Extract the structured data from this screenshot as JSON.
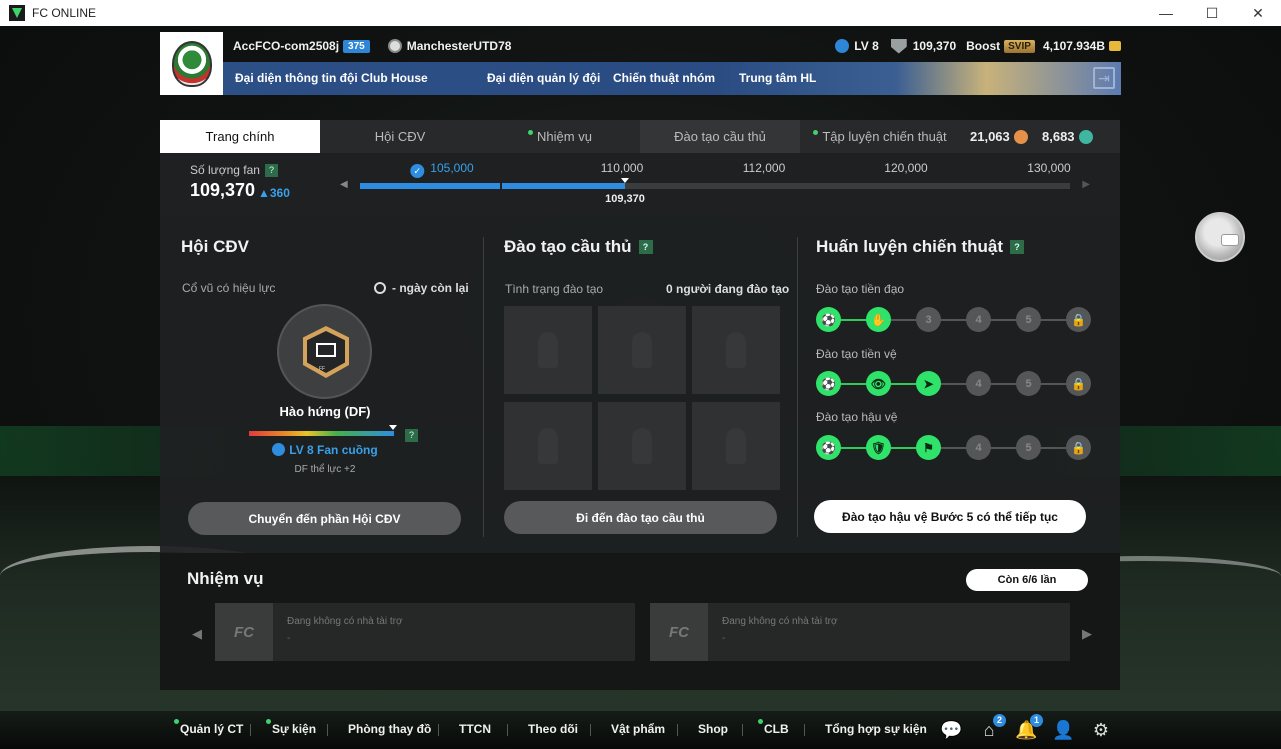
{
  "window": {
    "title": "FC ONLINE",
    "minimize": "—",
    "maximize": "☐",
    "close": "✕"
  },
  "header": {
    "account": "AccFCO-com2508j",
    "account_level": "375",
    "manager": "ManchesterUTD78",
    "level": "LV 8",
    "fans": "109,370",
    "boost_label": "Boost",
    "svip": "SVIP",
    "bp": "4,107.934B",
    "nav": [
      "Đại diện thông tin đội",
      "Club House",
      "Đại diện quản lý đội",
      "Chiến thuật nhóm",
      "Trung tâm HL"
    ],
    "exit_icon": "exit-icon"
  },
  "tabs": [
    {
      "label": "Trang chính",
      "active": true,
      "dot": false
    },
    {
      "label": "Hội CĐV",
      "active": false,
      "dot": false
    },
    {
      "label": "Nhiệm vụ",
      "active": false,
      "dot": true
    },
    {
      "label": "Đào tạo cầu thủ",
      "active": false,
      "dot": false
    },
    {
      "label": "Tập luyện chiến thuật",
      "active": false,
      "dot": true
    }
  ],
  "currency": {
    "orange": "21,063",
    "green": "8,683"
  },
  "fan_progress": {
    "label": "Số lượng fan",
    "help": "?",
    "value": "109,370",
    "delta": "▲360",
    "ticks": [
      "105,000",
      "110,000",
      "112,000",
      "120,000",
      "130,000"
    ],
    "current_label": "109,370",
    "reached_fraction": 0.373
  },
  "fan_club": {
    "title": "Hội CĐV",
    "effect_label": "Cổ vũ có hiệu lực",
    "days_left": "- ngày còn lại",
    "cheer_name": "Hào hứng (DF)",
    "fan_level": "LV 8 Fan cuồng",
    "bonus": "DF thể lực +2",
    "button": "Chuyển đến phần Hội CĐV",
    "badge_text": "FF"
  },
  "player_training": {
    "title": "Đào tạo cầu thủ",
    "status_label": "Tình trạng đào tạo",
    "status_value": "0 người đang đào tạo",
    "button": "Đi đến đào tạo cầu thủ"
  },
  "tactic_training": {
    "title": "Huấn luyện chiến thuật",
    "rows": [
      {
        "label": "Đào tạo tiền đạo",
        "steps": [
          "⚽",
          "✋",
          "3",
          "4",
          "5",
          "🔒"
        ],
        "done": 2
      },
      {
        "label": "Đào tạo tiền vệ",
        "steps": [
          "⚽",
          "👁",
          "➤",
          "4",
          "5",
          "🔒"
        ],
        "done": 3
      },
      {
        "label": "Đào tạo hậu vệ",
        "steps": [
          "⚽",
          "🛡",
          "⚑",
          "4",
          "5",
          "🔒"
        ],
        "done": 3
      }
    ],
    "button": "Đào tạo hậu vệ Bước 5 có thể tiếp tục"
  },
  "missions": {
    "title": "Nhiệm vụ",
    "count": "Còn 6/6 lần",
    "cards": [
      {
        "logo": "FC",
        "text": "Đang không có nhà tài trợ",
        "sub": "-"
      },
      {
        "logo": "FC",
        "text": "Đang không có nhà tài trợ",
        "sub": "-"
      }
    ],
    "prev": "◀",
    "next": "▶"
  },
  "bottom_nav": [
    {
      "label": "Quản lý CT",
      "dot": true
    },
    {
      "label": "Sự kiện",
      "dot": true
    },
    {
      "label": "Phòng thay đồ",
      "dot": false
    },
    {
      "label": "TTCN",
      "dot": false
    },
    {
      "label": "Theo dõi",
      "dot": false
    },
    {
      "label": "Vật phẩm",
      "dot": false
    },
    {
      "label": "Shop",
      "dot": false
    },
    {
      "label": "CLB",
      "dot": true
    },
    {
      "label": "Tổng hợp sự kiện",
      "dot": false
    }
  ],
  "bottom_icons": {
    "chat": "💬",
    "home": "⌂",
    "home_badge": "2",
    "bell": "🔔",
    "bell_badge": "1",
    "profile": "👤",
    "settings": "⚙"
  }
}
